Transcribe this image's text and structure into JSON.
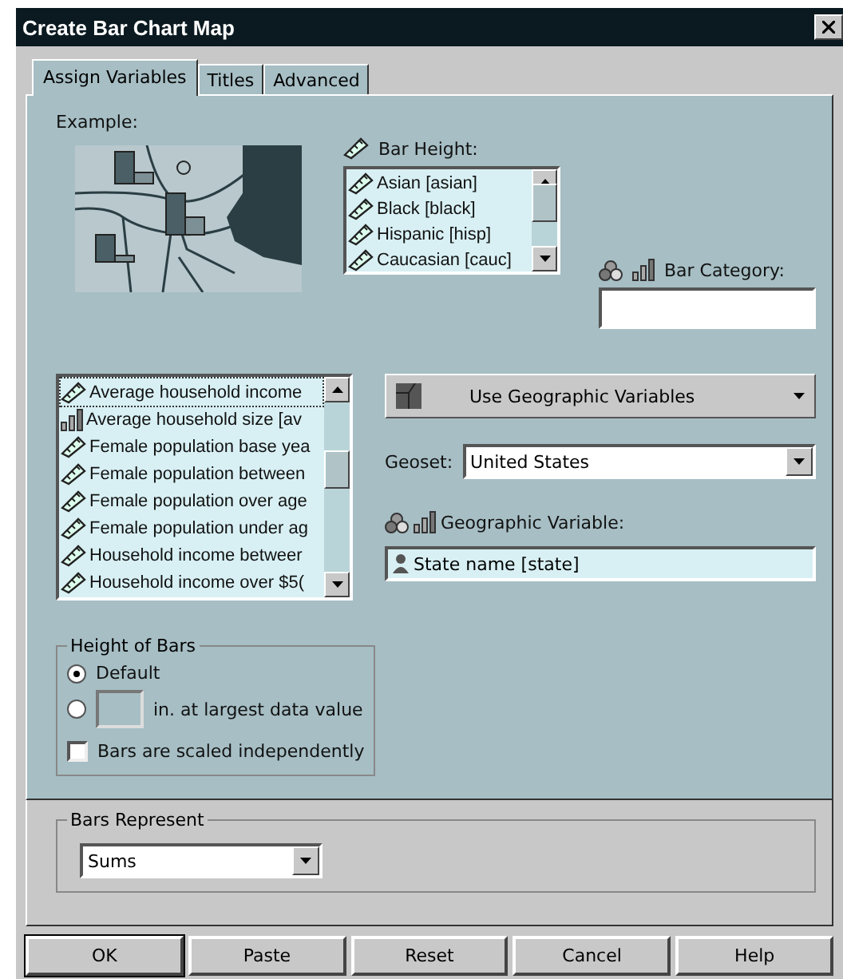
{
  "window": {
    "title": "Create Bar Chart Map"
  },
  "tabs": [
    {
      "label": "Assign Variables",
      "selected": true
    },
    {
      "label": "Titles",
      "selected": false
    },
    {
      "label": "Advanced",
      "selected": false
    }
  ],
  "example": {
    "label": "Example:"
  },
  "bar_height": {
    "label": "Bar Height:",
    "items": [
      {
        "label": "Asian [asian]",
        "kind": "scale"
      },
      {
        "label": "Black [black]",
        "kind": "scale"
      },
      {
        "label": "Hispanic [hisp]",
        "kind": "scale"
      },
      {
        "label": "Caucasian [cauc]",
        "kind": "scale"
      }
    ]
  },
  "bar_category": {
    "label": "Bar Category:"
  },
  "variables": [
    {
      "label": "Average household income",
      "kind": "scale",
      "selected": true
    },
    {
      "label": "Average household size [av",
      "kind": "ordinal",
      "selected": false
    },
    {
      "label": "Female population base yea",
      "kind": "scale",
      "selected": false
    },
    {
      "label": "Female population between",
      "kind": "scale",
      "selected": false
    },
    {
      "label": "Female population over age",
      "kind": "scale",
      "selected": false
    },
    {
      "label": "Female population under ag",
      "kind": "scale",
      "selected": false
    },
    {
      "label": "Household income betweer",
      "kind": "scale",
      "selected": false
    },
    {
      "label": "Household income over $5(",
      "kind": "scale",
      "selected": false
    }
  ],
  "geo_mode": {
    "value": "Use Geographic Variables"
  },
  "geoset": {
    "label": "Geoset:",
    "value": "United States"
  },
  "geographic_variable": {
    "label": "Geographic Variable:",
    "value": "State name [state]"
  },
  "height_of_bars": {
    "legend": "Height of Bars",
    "options": [
      {
        "label": "Default",
        "selected": true
      },
      {
        "label": "in. at largest data value",
        "selected": false
      }
    ],
    "checkbox": {
      "label": "Bars are scaled independently",
      "checked": false
    }
  },
  "bars_represent": {
    "legend": "Bars Represent",
    "value": "Sums"
  },
  "buttons": [
    "OK",
    "Paste",
    "Reset",
    "Cancel",
    "Help"
  ]
}
